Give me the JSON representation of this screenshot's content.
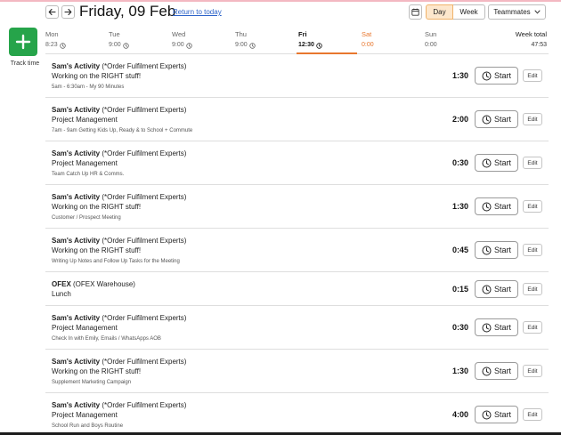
{
  "sidebar": {
    "track_time_label": "Track time"
  },
  "header": {
    "title": "Friday, 09 Feb",
    "return_link": "Return to today",
    "view_day": "Day",
    "view_week": "Week",
    "teammates": "Teammates"
  },
  "week": {
    "days": [
      {
        "name": "Mon",
        "time": "8:23",
        "clock": true
      },
      {
        "name": "Tue",
        "time": "9:00",
        "clock": true
      },
      {
        "name": "Wed",
        "time": "9:00",
        "clock": true
      },
      {
        "name": "Thu",
        "time": "9:00",
        "clock": true
      },
      {
        "name": "Fri",
        "time": "12:30",
        "clock": true
      },
      {
        "name": "Sat",
        "time": "0:00",
        "clock": false
      },
      {
        "name": "Sun",
        "time": "0:00",
        "clock": false
      }
    ],
    "total_label": "Week total",
    "total_value": "47:53"
  },
  "entries": [
    {
      "project": "Sam's Activity",
      "client": "(*Order Fulfilment Experts)",
      "task": "Working on the RIGHT stuff!",
      "note": "5am - 6:30am - My 90 Minutes",
      "duration": "1:30"
    },
    {
      "project": "Sam's Activity",
      "client": "(*Order Fulfilment Experts)",
      "task": "Project Management",
      "note": "7am - 9am Getting Kids Up, Ready & to School + Commute",
      "duration": "2:00"
    },
    {
      "project": "Sam's Activity",
      "client": "(*Order Fulfilment Experts)",
      "task": "Project Management",
      "note": "Team Catch Up HR & Comms.",
      "duration": "0:30"
    },
    {
      "project": "Sam's Activity",
      "client": "(*Order Fulfilment Experts)",
      "task": "Working on the RIGHT stuff!",
      "note": "Customer / Prospect Meeting",
      "duration": "1:30"
    },
    {
      "project": "Sam's Activity",
      "client": "(*Order Fulfilment Experts)",
      "task": "Working on the RIGHT stuff!",
      "note": "Writing Up Notes and Follow Up Tasks for the Meeting",
      "duration": "0:45"
    },
    {
      "project": "OFEX",
      "client": "(OFEX Warehouse)",
      "task": "Lunch",
      "note": "",
      "duration": "0:15"
    },
    {
      "project": "Sam's Activity",
      "client": "(*Order Fulfilment Experts)",
      "task": "Project Management",
      "note": "Check In with Emily, Emails / WhatsApps AOB",
      "duration": "0:30"
    },
    {
      "project": "Sam's Activity",
      "client": "(*Order Fulfilment Experts)",
      "task": "Working on the RIGHT stuff!",
      "note": "Supplement Marketing Campaign",
      "duration": "1:30"
    },
    {
      "project": "Sam's Activity",
      "client": "(*Order Fulfilment Experts)",
      "task": "Project Management",
      "note": "School Run and Boys Routine",
      "duration": "4:00"
    }
  ],
  "labels": {
    "start": "Start",
    "edit": "Edit"
  },
  "colors": {
    "accent": "#e8772e",
    "track_green": "#26a44a",
    "link": "#2b62c8"
  }
}
